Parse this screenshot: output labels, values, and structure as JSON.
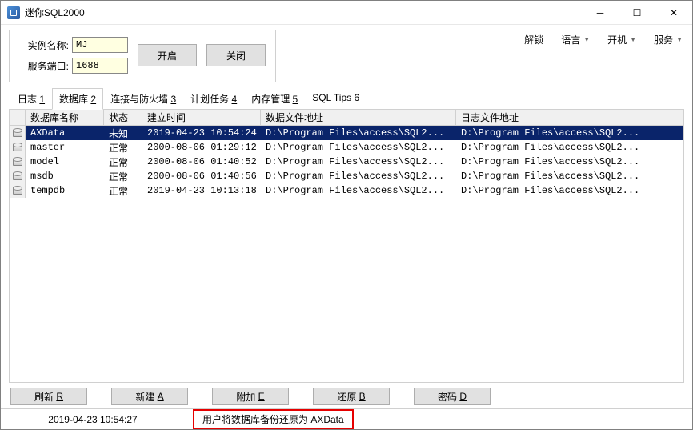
{
  "window": {
    "title": "迷你SQL2000"
  },
  "instance": {
    "name_label": "实例名称:",
    "name_value": "MJ",
    "port_label": "服务端口:",
    "port_value": "1688",
    "start_btn": "开启",
    "stop_btn": "关闭"
  },
  "menus": {
    "unlock": "解锁",
    "lang": "语言",
    "boot": "开机",
    "service": "服务"
  },
  "tabs": [
    {
      "label": "日志",
      "key": "1"
    },
    {
      "label": "数据库",
      "key": "2"
    },
    {
      "label": "连接与防火墙",
      "key": "3"
    },
    {
      "label": "计划任务",
      "key": "4"
    },
    {
      "label": "内存管理",
      "key": "5"
    },
    {
      "label": "SQL Tips",
      "key": "6"
    }
  ],
  "columns": {
    "name": "数据库名称",
    "status": "状态",
    "created": "建立时间",
    "data_path": "数据文件地址",
    "log_path": "日志文件地址"
  },
  "rows": [
    {
      "name": "AXData",
      "status": "未知",
      "created": "2019-04-23 10:54:24",
      "data": "D:\\Program Files\\access\\SQL2...",
      "log": "D:\\Program Files\\access\\SQL2...",
      "selected": true
    },
    {
      "name": "master",
      "status": "正常",
      "created": "2000-08-06 01:29:12",
      "data": "D:\\Program Files\\access\\SQL2...",
      "log": "D:\\Program Files\\access\\SQL2..."
    },
    {
      "name": "model",
      "status": "正常",
      "created": "2000-08-06 01:40:52",
      "data": "D:\\Program Files\\access\\SQL2...",
      "log": "D:\\Program Files\\access\\SQL2..."
    },
    {
      "name": "msdb",
      "status": "正常",
      "created": "2000-08-06 01:40:56",
      "data": "D:\\Program Files\\access\\SQL2...",
      "log": "D:\\Program Files\\access\\SQL2..."
    },
    {
      "name": "tempdb",
      "status": "正常",
      "created": "2019-04-23 10:13:18",
      "data": "D:\\Program Files\\access\\SQL2...",
      "log": "D:\\Program Files\\access\\SQL2..."
    }
  ],
  "actions": {
    "refresh": {
      "label": "刷新",
      "key": "R"
    },
    "new": {
      "label": "新建",
      "key": "A"
    },
    "attach": {
      "label": "附加",
      "key": "E"
    },
    "restore": {
      "label": "还原",
      "key": "B"
    },
    "password": {
      "label": "密码",
      "key": "D"
    }
  },
  "status": {
    "time": "2019-04-23 10:54:27",
    "msg": "用户将数据库备份还原为 AXData"
  }
}
